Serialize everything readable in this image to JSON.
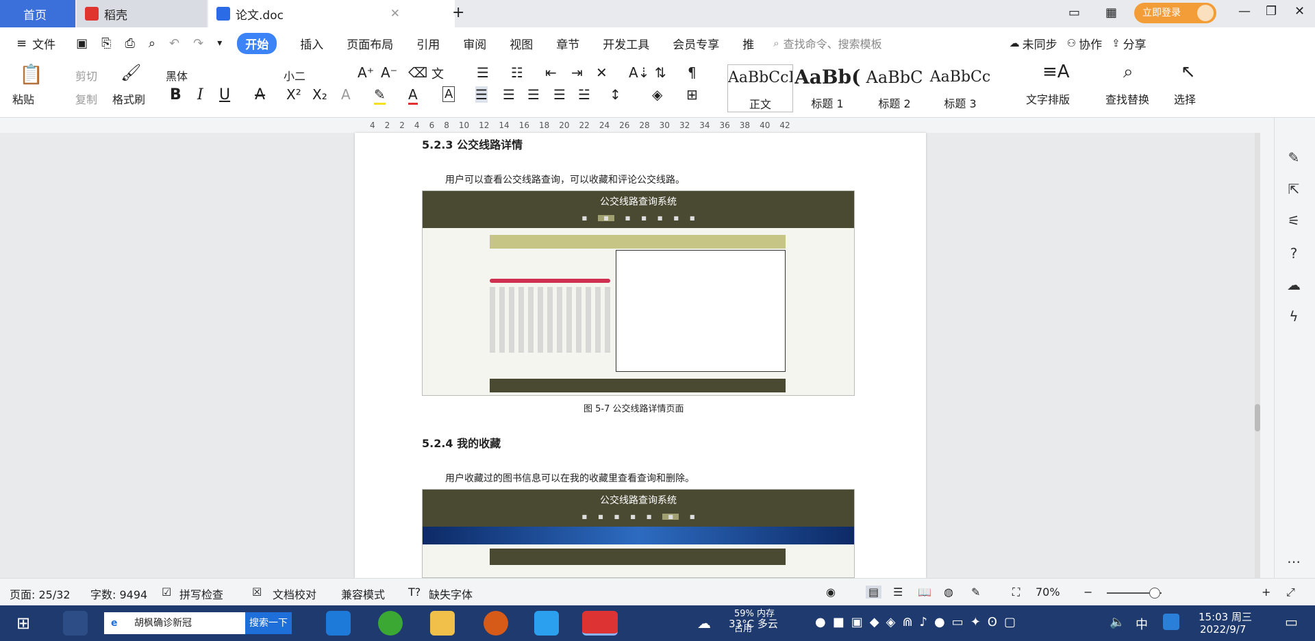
{
  "tabs": {
    "home": "首页",
    "docer": "稻壳",
    "document": "论文.doc"
  },
  "titlebar": {
    "signin_label": "立即登录"
  },
  "menu": {
    "file": "文件",
    "items": [
      "开始",
      "插入",
      "页面布局",
      "引用",
      "审阅",
      "视图",
      "章节",
      "开发工具",
      "会员专享",
      "推"
    ],
    "search_placeholder": "查找命令、搜索模板",
    "sync": "未同步",
    "collab": "协作",
    "share": "分享"
  },
  "ribbon": {
    "paste": "粘贴",
    "cut": "剪切",
    "copy": "复制",
    "format_painter": "格式刷",
    "font_name": "黑体",
    "font_size": "小二",
    "styles": [
      {
        "preview": "AaBbCcDd",
        "label": "正文"
      },
      {
        "preview": "AaBb(",
        "label": "标题 1"
      },
      {
        "preview": "AaBbC",
        "label": "标题 2"
      },
      {
        "preview": "AaBbCc",
        "label": "标题 3"
      }
    ],
    "text_layout": "文字排版",
    "find_replace": "查找替换",
    "select": "选择"
  },
  "ruler": {
    "ticks": [
      "4",
      "2",
      "2",
      "4",
      "6",
      "8",
      "10",
      "12",
      "14",
      "16",
      "18",
      "20",
      "22",
      "24",
      "26",
      "28",
      "30",
      "32",
      "34",
      "36",
      "38",
      "40",
      "42"
    ]
  },
  "document": {
    "section1_heading": "5.2.3  公交线路详情",
    "section1_text": "用户可以查看公交线路查询，可以收藏和评论公交线路。",
    "fig1_title": "公交线路查询系统",
    "fig1_caption": "图 5-7  公交线路详情页面",
    "section2_heading": "5.2.4  我的收藏",
    "section2_text": "用户收藏过的图书信息可以在我的收藏里查看查询和删除。",
    "fig2_title": "公交线路查询系统"
  },
  "statusbar": {
    "page": "页面: 25/32",
    "words": "字数: 9494",
    "spellcheck": "拼写检查",
    "proofread": "文档校对",
    "compat": "兼容模式",
    "missing_font": "缺失字体",
    "zoom": "70%"
  },
  "taskbar": {
    "search_text": "胡枫确诊新冠",
    "search_button": "搜索一下",
    "weather": "33°C 多云",
    "memory": "59% 内存占用",
    "ime": "中",
    "time": "15:03 周三",
    "date": "2022/9/7"
  }
}
